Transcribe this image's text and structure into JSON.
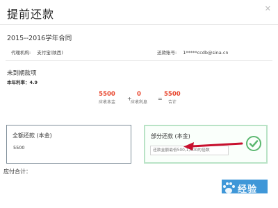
{
  "dialog": {
    "title": "提前还款"
  },
  "contract": {
    "title": "2015--2016学年合同",
    "agency_label": "代理机构:",
    "agency_value": "支付宝(陕西)",
    "account_label": "还款账号:",
    "account_value": "1*****ccdb@sina.cn"
  },
  "unpaid": {
    "title": "未到期款项",
    "rate": "本年利率：4.9"
  },
  "calc": {
    "principal": {
      "value": "5500",
      "label": "应收本金"
    },
    "plus": "+",
    "interest": {
      "value": "0",
      "label": "应收利息"
    },
    "equals": "=",
    "total": {
      "value": "5500",
      "label": "合计"
    }
  },
  "full_payment": {
    "title": "全额还款 (本金)",
    "amount": "5500"
  },
  "partial_payment": {
    "title": "部分还款 (本金)",
    "placeholder": "还款金额最低500,1,000的倍数"
  },
  "payable": {
    "label": "应付合计："
  },
  "footer": {
    "confirm_label": ""
  },
  "watermark": {
    "text": "经验"
  },
  "colors": {
    "accent": "#e8452c",
    "button": "#3f97d8",
    "selected_border": "#b9e3c6",
    "check": "#5cb870",
    "arrow": "#c8102e"
  },
  "icons": {
    "close": "close-icon",
    "check": "check-circle-icon",
    "arrow": "red-arrow-icon",
    "watermark": "paw-icon"
  }
}
